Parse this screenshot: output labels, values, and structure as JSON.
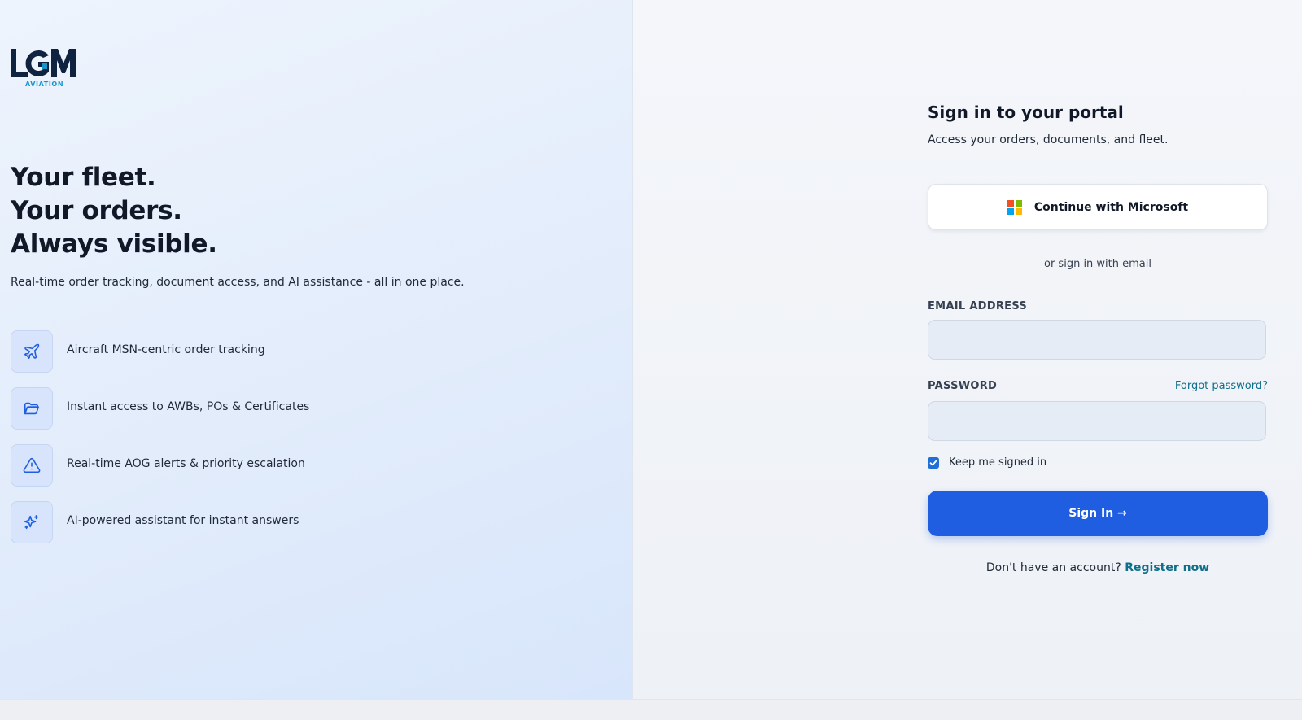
{
  "brand": {
    "logo_text": "LGM",
    "logo_sub": "AVIATION",
    "primary_color": "#1f5ee0",
    "accent_color": "#1597c9"
  },
  "hero": {
    "headline": [
      "Your fleet.",
      "Your orders.",
      "Always visible."
    ],
    "tagline": "Real-time order tracking, document access, and AI assistance - all in one place."
  },
  "features": [
    {
      "icon": "airplane-icon",
      "text": "Aircraft MSN-centric order tracking"
    },
    {
      "icon": "folder-icon",
      "text": "Instant access to AWBs, POs & Certificates"
    },
    {
      "icon": "warning-icon",
      "text": "Real-time AOG alerts & priority escalation"
    },
    {
      "icon": "sparkles-icon",
      "text": "AI-powered assistant for instant answers"
    }
  ],
  "login": {
    "title": "Sign in to your portal",
    "subtitle": "Access your orders, documents, and fleet.",
    "microsoft_button": "Continue with Microsoft",
    "divider_text": "or sign in with email",
    "email_label": "EMAIL ADDRESS",
    "email_value": "",
    "email_placeholder": "",
    "password_label": "PASSWORD",
    "password_value": "",
    "password_placeholder": "",
    "forgot_password": "Forgot password?",
    "remember_label": "Keep me signed in",
    "remember_checked": true,
    "signin_button": "Sign In →",
    "register_prompt": "Don't have an account?",
    "register_link": "Register now"
  }
}
